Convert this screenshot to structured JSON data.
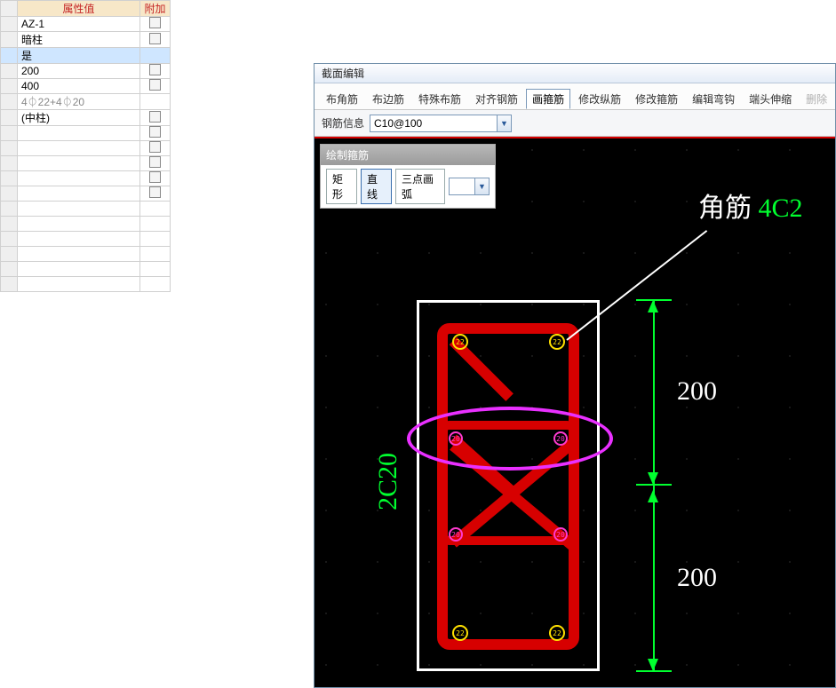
{
  "grid": {
    "headers": {
      "value": "属性值",
      "extra": "附加"
    },
    "rows": [
      {
        "value": "AZ-1",
        "check": false,
        "sel": false,
        "dim": false
      },
      {
        "value": "暗柱",
        "check": false,
        "sel": false,
        "dim": false
      },
      {
        "value": "是",
        "check": null,
        "sel": true,
        "dim": false
      },
      {
        "value": "200",
        "check": false,
        "sel": false,
        "dim": false
      },
      {
        "value": "400",
        "check": false,
        "sel": false,
        "dim": false
      },
      {
        "value": "4⏀22+4⏀20",
        "check": null,
        "sel": false,
        "dim": true
      },
      {
        "value": "(中柱)",
        "check": false,
        "sel": false,
        "dim": false
      },
      {
        "value": "",
        "check": false,
        "sel": false,
        "dim": false
      },
      {
        "value": "",
        "check": false,
        "sel": false,
        "dim": false
      },
      {
        "value": "",
        "check": false,
        "sel": false,
        "dim": false
      },
      {
        "value": "",
        "check": false,
        "sel": false,
        "dim": false
      },
      {
        "value": "",
        "check": false,
        "sel": false,
        "dim": false
      },
      {
        "value": "",
        "check": null,
        "sel": false,
        "dim": false
      },
      {
        "value": "",
        "check": null,
        "sel": false,
        "dim": false
      },
      {
        "value": "",
        "check": null,
        "sel": false,
        "dim": false
      },
      {
        "value": "",
        "check": null,
        "sel": false,
        "dim": false
      },
      {
        "value": "",
        "check": null,
        "sel": false,
        "dim": false
      },
      {
        "value": "",
        "check": null,
        "sel": false,
        "dim": false
      }
    ]
  },
  "editor": {
    "title": "截面编辑",
    "tabs": [
      {
        "label": "布角筋",
        "state": ""
      },
      {
        "label": "布边筋",
        "state": ""
      },
      {
        "label": "特殊布筋",
        "state": ""
      },
      {
        "label": "对齐钢筋",
        "state": ""
      },
      {
        "label": "画箍筋",
        "state": "active"
      },
      {
        "label": "修改纵筋",
        "state": ""
      },
      {
        "label": "修改箍筋",
        "state": ""
      },
      {
        "label": "编辑弯钩",
        "state": ""
      },
      {
        "label": "端头伸缩",
        "state": ""
      },
      {
        "label": "删除",
        "state": "disabled"
      }
    ],
    "info": {
      "label": "钢筋信息",
      "value": "C10@100"
    },
    "drawpanel": {
      "title": "绘制箍筋",
      "buttons": [
        {
          "label": "矩形",
          "state": ""
        },
        {
          "label": "直线",
          "state": "active"
        },
        {
          "label": "三点画弧",
          "state": ""
        }
      ]
    }
  },
  "cad": {
    "rebars": {
      "corner_dia": "22",
      "mid_dia": "20"
    },
    "dims": {
      "upper": "200",
      "lower": "200"
    },
    "side_label": "2C20",
    "label_text": "角筋",
    "label_extra": "4C2"
  }
}
